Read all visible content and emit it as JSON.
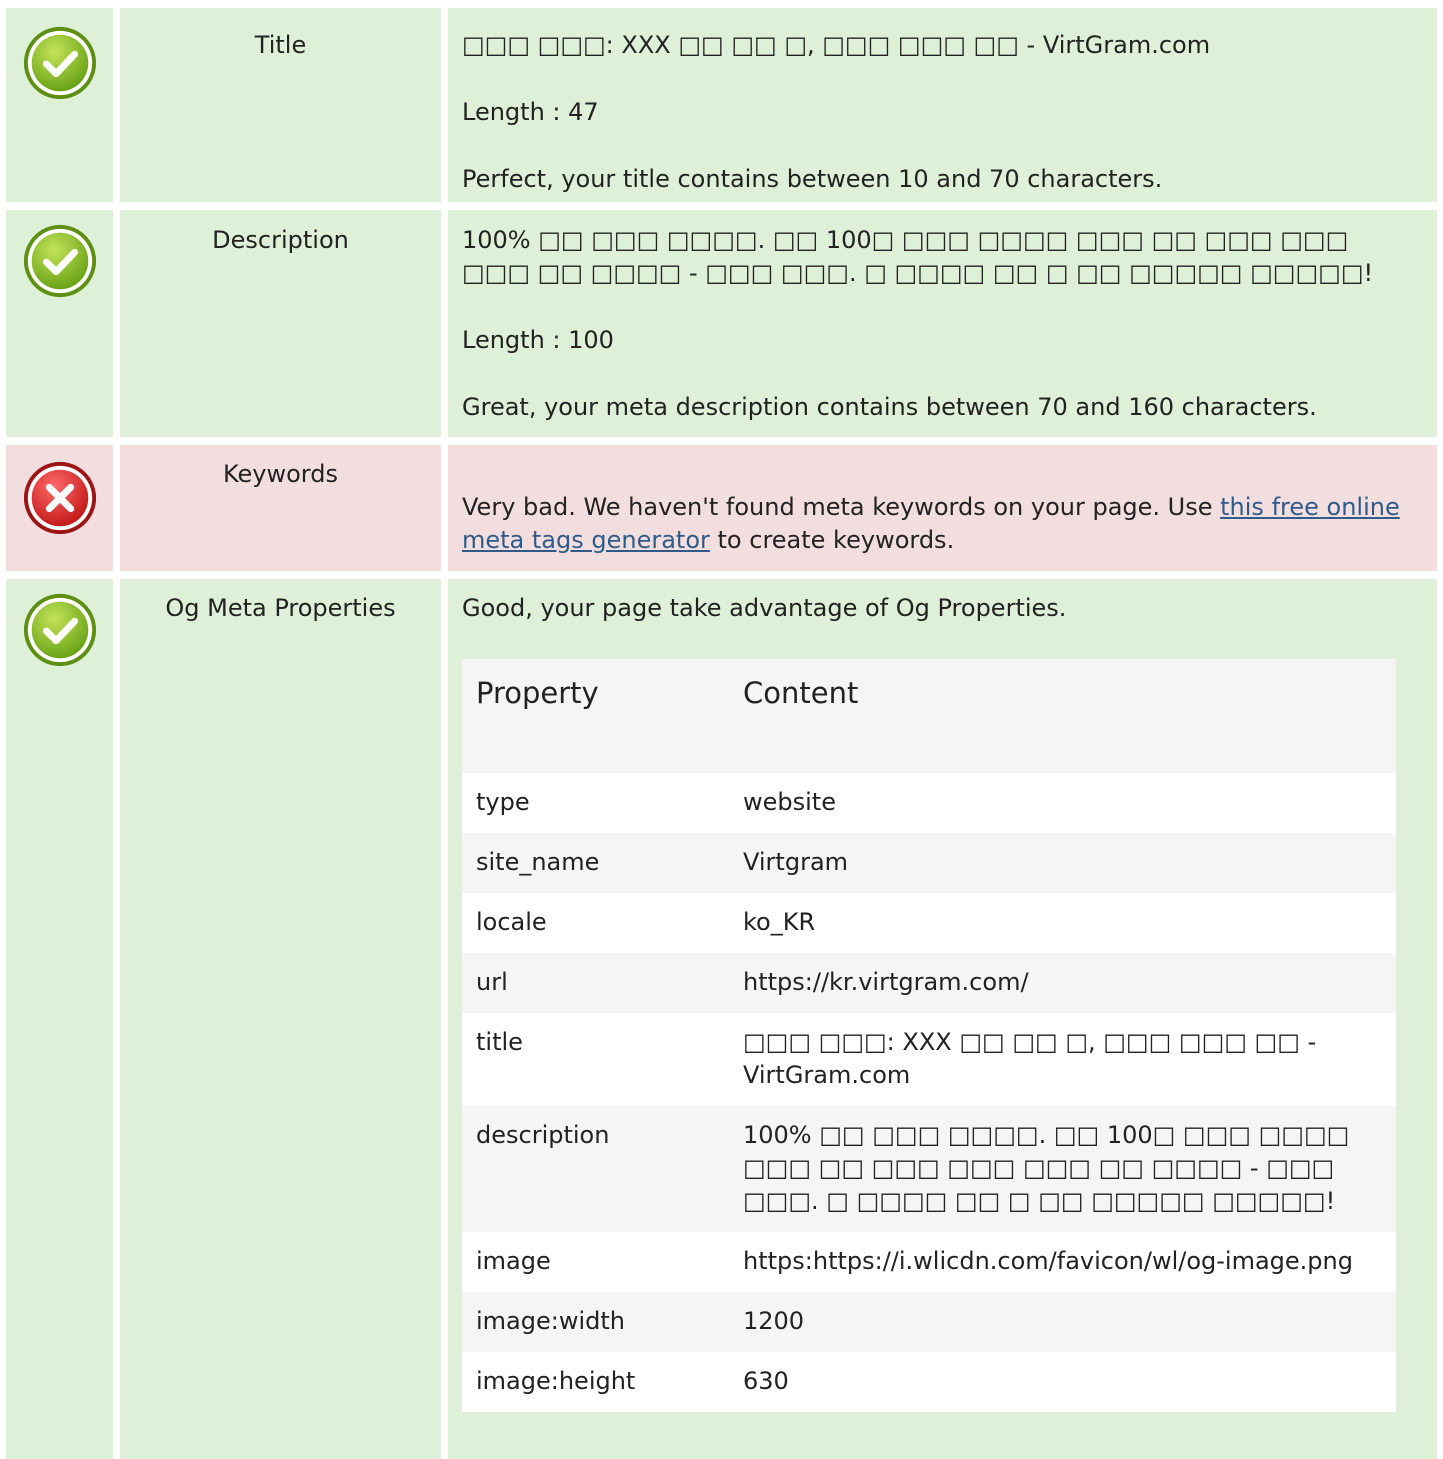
{
  "rows": {
    "title": {
      "status": "pass",
      "label": "Title",
      "value": "□□□ □□□: XXX □□ □□ □, □□□ □□□ □□ - VirtGram.com",
      "length_text": "Length : 47",
      "message": "Perfect, your title contains between 10 and 70 characters."
    },
    "description": {
      "status": "pass",
      "label": "Description",
      "value": "100% □□ □□□ □□□□. □□ 100□ □□□ □□□□ □□□ □□ □□□ □□□ □□□ □□ □□□□ - □□□ □□□. □ □□□□ □□ □ □□ □□□□□ □□□□□!",
      "length_text": "Length : 100",
      "message": "Great, your meta description contains between 70 and 160 characters."
    },
    "keywords": {
      "status": "fail",
      "label": "Keywords",
      "message_before": "Very bad. We haven't found meta keywords on your page. Use ",
      "link_text": "this free online meta tags generator",
      "message_after": " to create keywords."
    },
    "og": {
      "status": "pass",
      "label": "Og Meta Properties",
      "message": "Good, your page take advantage of Og Properties.",
      "table": {
        "headers": [
          "Property",
          "Content"
        ],
        "rows": [
          [
            "type",
            "website"
          ],
          [
            "site_name",
            "Virtgram"
          ],
          [
            "locale",
            "ko_KR"
          ],
          [
            "url",
            "https://kr.virtgram.com/"
          ],
          [
            "title",
            "□□□ □□□: XXX □□ □□ □, □□□ □□□ □□ - VirtGram.com"
          ],
          [
            "description",
            "100% □□ □□□ □□□□. □□ 100□ □□□ □□□□ □□□ □□ □□□ □□□ □□□ □□ □□□□ - □□□ □□□. □ □□□□ □□ □ □□ □□□□□ □□□□□!"
          ],
          [
            "image",
            "https:https://i.wlicdn.com/favicon/wl/og-image.png"
          ],
          [
            "image:width",
            "1200"
          ],
          [
            "image:height",
            "630"
          ]
        ]
      }
    }
  },
  "colors": {
    "pass_bg": "#dff0d8",
    "fail_bg": "#f2dede",
    "link": "#2f5b8a"
  },
  "icons": {
    "pass": "check-circle-icon",
    "fail": "x-circle-icon"
  }
}
